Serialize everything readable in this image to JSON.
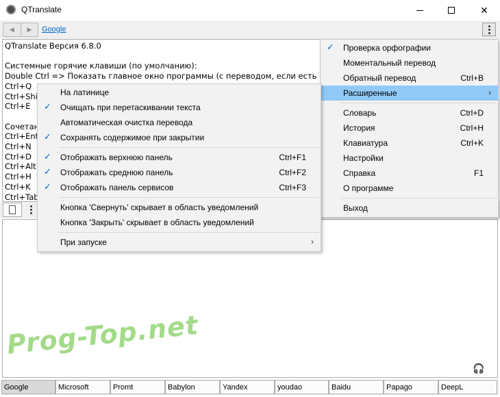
{
  "window": {
    "title": "QTranslate"
  },
  "nav": {
    "back": "◀",
    "forward": "▶",
    "engine_link": "Google"
  },
  "source_lines": [
    "QTranslate Версия  6.8.0",
    "",
    "Системные горячие клавиши (по умолчанию):",
    "Double Ctrl => Показать главное окно программы (с переводом, если есть выде",
    "Ctrl+Q",
    "Ctrl+Shif",
    "Ctrl+E",
    "",
    "Сочетан",
    "Ctrl+Ent",
    "Ctrl+N",
    "Ctrl+D",
    "Ctrl+Alt+",
    "Ctrl+H",
    "Ctrl+K",
    "Ctrl+Tab"
  ],
  "main_menu": [
    {
      "label": "Проверка орфографии",
      "shortcut": "",
      "checked": true
    },
    {
      "label": "Моментальный перевод",
      "shortcut": "",
      "checked": false
    },
    {
      "label": "Обратный перевод",
      "shortcut": "Ctrl+B",
      "checked": false
    },
    {
      "label": "Расширенные",
      "shortcut": "",
      "checked": false,
      "submenu": true,
      "highlighted": true
    },
    {
      "separator": true
    },
    {
      "label": "Словарь",
      "shortcut": "Ctrl+D",
      "checked": false
    },
    {
      "label": "История",
      "shortcut": "Ctrl+H",
      "checked": false
    },
    {
      "label": "Клавиатура",
      "shortcut": "Ctrl+K",
      "checked": false
    },
    {
      "label": "Настройки",
      "shortcut": "",
      "checked": false
    },
    {
      "label": "Справка",
      "shortcut": "F1",
      "checked": false
    },
    {
      "label": "О программе",
      "shortcut": "",
      "checked": false
    },
    {
      "separator": true
    },
    {
      "label": "Выход",
      "shortcut": "",
      "checked": false
    }
  ],
  "sub_menu": [
    {
      "label": "На латинице",
      "shortcut": "",
      "checked": false
    },
    {
      "label": "Очищать при перетаскивании текста",
      "shortcut": "",
      "checked": true
    },
    {
      "label": "Автоматическая очистка перевода",
      "shortcut": "",
      "checked": false
    },
    {
      "label": "Сохранять содержимое при закрытии",
      "shortcut": "",
      "checked": true
    },
    {
      "separator": true
    },
    {
      "label": "Отображать верхнюю панель",
      "shortcut": "Ctrl+F1",
      "checked": true
    },
    {
      "label": "Отображать среднюю панель",
      "shortcut": "Ctrl+F2",
      "checked": true
    },
    {
      "label": "Отображать панель сервисов",
      "shortcut": "Ctrl+F3",
      "checked": true
    },
    {
      "separator": true
    },
    {
      "label": "Кнопка 'Свернуть' скрывает в область уведомлений",
      "shortcut": "",
      "checked": false
    },
    {
      "label": "Кнопка 'Закрыть' скрывает в область уведомлений",
      "shortcut": "",
      "checked": false
    },
    {
      "separator": true
    },
    {
      "label": "При запуске",
      "shortcut": "",
      "checked": false,
      "submenu": true
    }
  ],
  "service_tabs": [
    "Google",
    "Microsoft",
    "Promt",
    "Babylon",
    "Yandex",
    "youdao",
    "Baidu",
    "Papago",
    "DeepL"
  ],
  "active_service": "Google",
  "watermark": "Prog-Top.net",
  "colors": {
    "menu_highlight": "#91c9f7",
    "check": "#0a63c9",
    "link": "#0066cc",
    "watermark": "#58be28"
  },
  "icons": {
    "check": "✓",
    "submenu_arrow": "›",
    "headphones": "🎧",
    "close": "✕"
  }
}
